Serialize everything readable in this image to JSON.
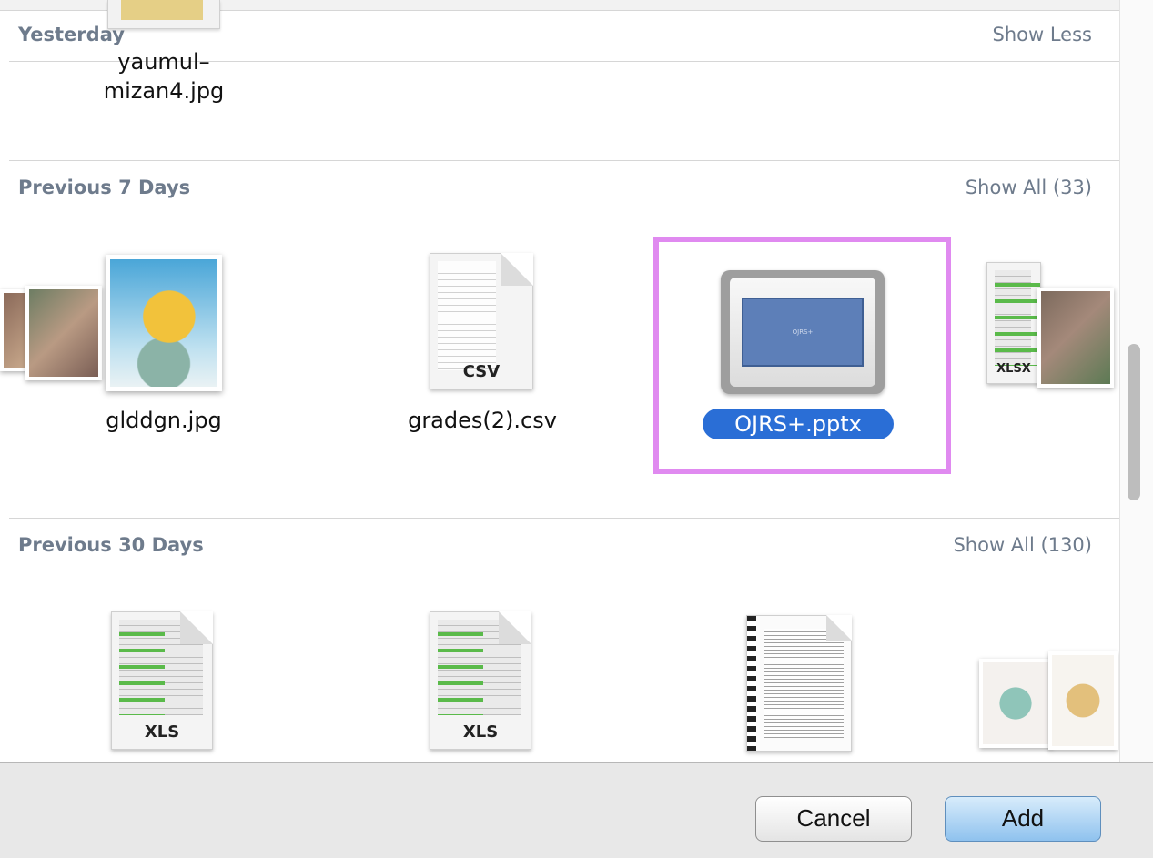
{
  "window": {
    "top_strip_text": ""
  },
  "sections": [
    {
      "title": "Yesterday",
      "link": "Show Less"
    },
    {
      "title": "Previous 7 Days",
      "link": "Show All (33)"
    },
    {
      "title": "Previous 30 Days",
      "link": "Show All (130)"
    }
  ],
  "yesterday_items": [
    {
      "label_line1": "yaumul–",
      "label_line2": "mizan4.jpg"
    }
  ],
  "week_items": [
    {
      "label": "glddgn.jpg"
    },
    {
      "label": "grades(2).csv",
      "ext": "CSV"
    },
    {
      "label": "OJRS+.pptx",
      "slide_text": "OJRS+"
    }
  ],
  "month_items": [
    {
      "ext": "XLS"
    },
    {
      "ext": "XLS"
    }
  ],
  "stack_ext": "XLSX",
  "buttons": {
    "cancel": "Cancel",
    "add": "Add"
  },
  "colors": {
    "selection_border": "#e08af0",
    "selected_label_bg": "#2a6ed6",
    "header_text": "#6e7b8c"
  }
}
